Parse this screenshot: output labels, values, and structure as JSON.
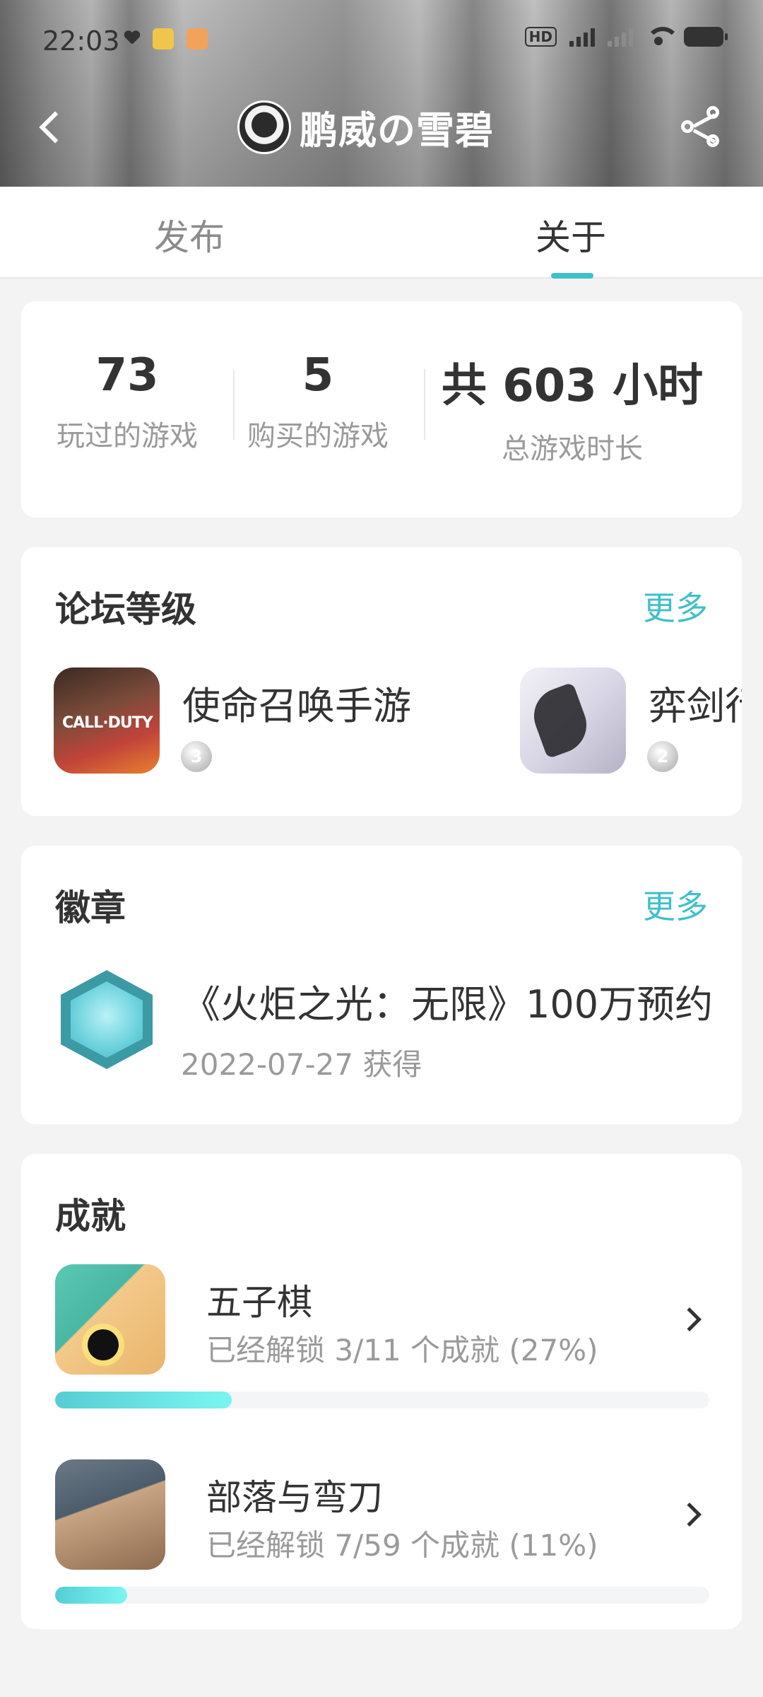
{
  "status_bar": {
    "time": "22:03",
    "icons_left": [
      "heart-icon",
      "app-100-icon",
      "app-browser-icon"
    ],
    "network": "5G",
    "hd_label": "HD"
  },
  "header": {
    "profile_name": "鹏威の雪碧",
    "back_icon": "back-arrow-icon",
    "share_icon": "share-icon"
  },
  "tabs": [
    {
      "label": "发布",
      "active": false
    },
    {
      "label": "关于",
      "active": true
    }
  ],
  "colors": {
    "accent": "#3fc0c9",
    "text": "#333333",
    "muted": "#9a9a9a",
    "background": "#f3f3f3"
  },
  "stats": [
    {
      "value": "73",
      "label": "玩过的游戏"
    },
    {
      "value": "5",
      "label": "购买的游戏"
    },
    {
      "value": "共 603 小时",
      "label": "总游戏时长"
    }
  ],
  "forum_level": {
    "title": "论坛等级",
    "more": "更多",
    "items": [
      {
        "name": "使命召唤手游",
        "icon_text": "CALL·DUTY",
        "level": "3"
      },
      {
        "name": "弈剑行",
        "level": "2"
      }
    ]
  },
  "badges": {
    "title": "徽章",
    "more": "更多",
    "items": [
      {
        "title": "《火炬之光：无限》100万预约",
        "date": "2022-07-27 获得"
      }
    ]
  },
  "achievements": {
    "title": "成就",
    "items": [
      {
        "name": "五子棋",
        "summary": "已经解锁 3/11 个成就 (27%)",
        "progress": 0.27
      },
      {
        "name": "部落与弯刀",
        "summary": "已经解锁 7/59 个成就 (11%)",
        "progress": 0.11
      }
    ]
  }
}
